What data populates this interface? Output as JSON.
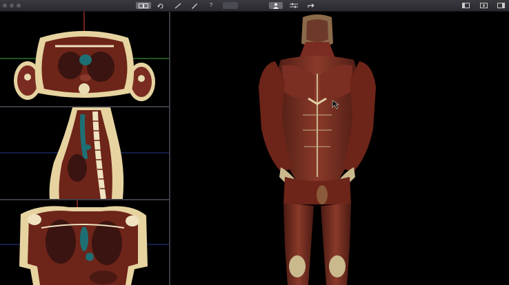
{
  "window": {
    "traffic_lights": [
      "close",
      "minimize",
      "zoom"
    ]
  },
  "toolbar": {
    "left_group": [
      {
        "name": "view-layout-button",
        "icon": "layout-icon"
      },
      {
        "name": "rotate-button",
        "icon": "rotate-icon"
      },
      {
        "name": "scalpel-button",
        "icon": "scalpel-icon"
      },
      {
        "name": "pen-button",
        "icon": "pen-icon"
      },
      {
        "name": "help-button",
        "icon": "question-icon",
        "label": "?"
      }
    ],
    "center_group": [
      {
        "name": "person-button",
        "icon": "person-icon"
      },
      {
        "name": "sliders-button",
        "icon": "sliders-icon"
      },
      {
        "name": "share-button",
        "icon": "share-icon"
      }
    ],
    "right_group": [
      {
        "name": "left-panel-button",
        "icon": "panel-left-icon"
      },
      {
        "name": "info-button",
        "icon": "info-icon"
      },
      {
        "name": "right-panel-button",
        "icon": "panel-right-icon"
      }
    ]
  },
  "panes": {
    "axial": {
      "label": "axial-slice"
    },
    "sagittal": {
      "label": "sagittal-slice"
    },
    "coronal": {
      "label": "coronal-slice"
    }
  },
  "colors": {
    "toolbar": "#2e2e33",
    "divider": "#3b3b43",
    "muscle": "#7a2c22",
    "tissue": "#e6d3a0",
    "tendon": "#d8c89a",
    "crosshair_red": "#c0392b",
    "crosshair_green": "#2e8b3a",
    "crosshair_blue": "#2a3a8c"
  }
}
